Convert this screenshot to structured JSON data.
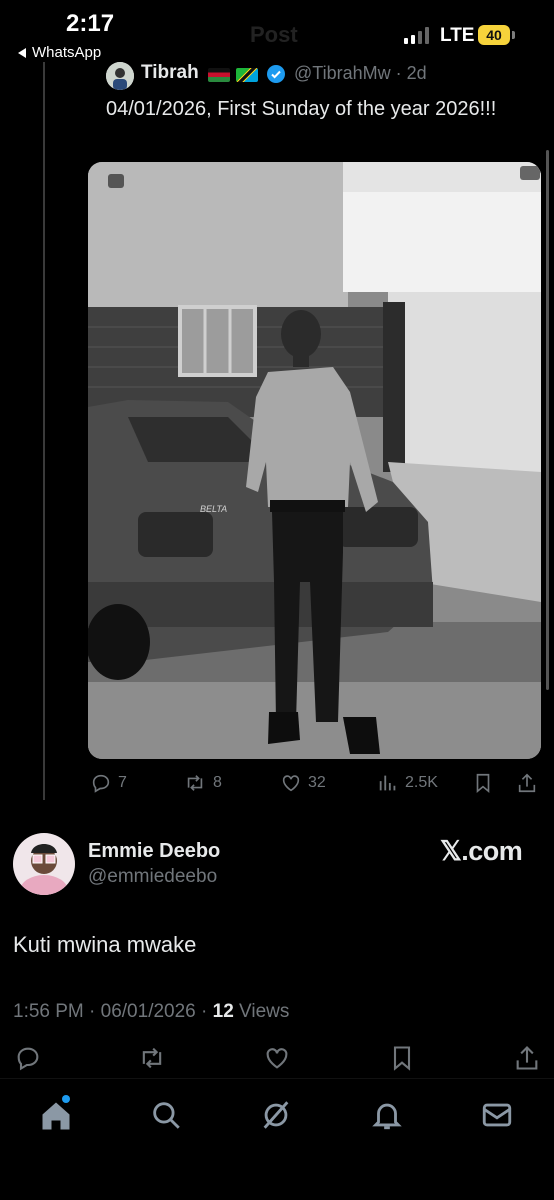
{
  "status_bar": {
    "time": "2:17",
    "back_app": "WhatsApp",
    "network": "LTE",
    "battery": "40"
  },
  "header": {
    "title": "Post"
  },
  "quoted_tweet": {
    "name": "Tibrah",
    "handle_time": "@TibrahMw · 2d",
    "text": "04/01/2026, First Sunday of the year 2026!!!",
    "image_caption_badge": "BELTA",
    "actions": {
      "replies": "7",
      "reposts": "8",
      "likes": "32",
      "views": "2.5K"
    }
  },
  "tweet": {
    "author": "Emmie Deebo",
    "handle": "@emmiedeebo",
    "source": "𝕏.com",
    "text": "Kuti mwina mwake",
    "timestamp": "1:56 PM · 06/01/2026 · ",
    "views_count": "12",
    "views_label": " Views"
  },
  "icons": {
    "reply": "reply-icon",
    "repost": "repost-icon",
    "like": "heart-icon",
    "views": "views-icon",
    "bookmark": "bookmark-icon",
    "share": "share-icon",
    "home": "home-icon",
    "search": "search-icon",
    "grok": "grok-icon",
    "notifications": "bell-icon",
    "messages": "mail-icon"
  },
  "colors": {
    "background": "#000000",
    "text": "#e7e9ea",
    "muted": "#71767b",
    "accent": "#1d9bf0",
    "battery": "#f6d33b"
  }
}
